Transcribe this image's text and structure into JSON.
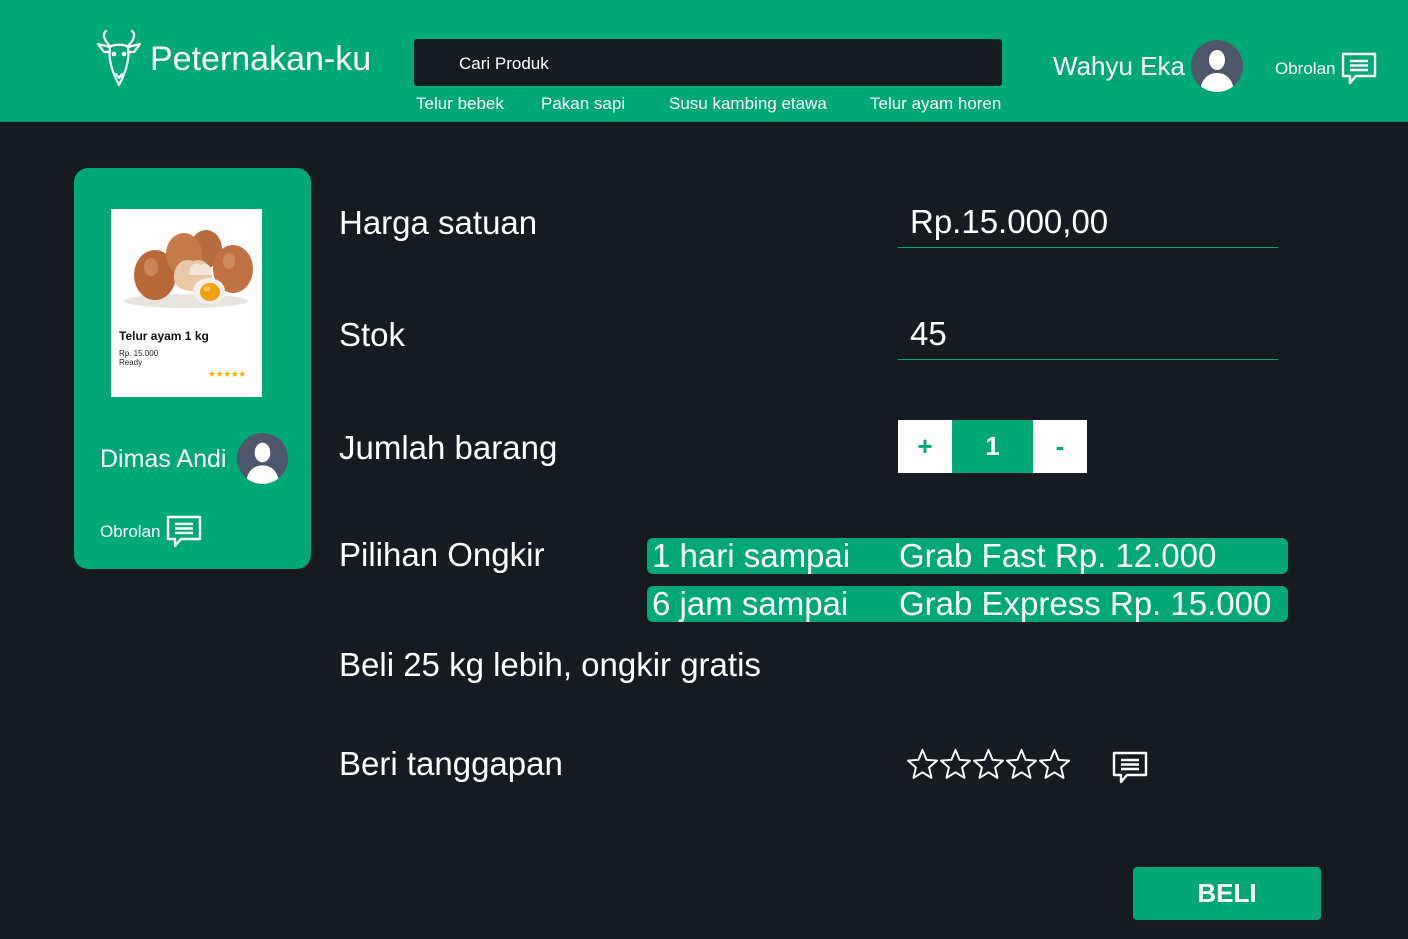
{
  "header": {
    "app_title": "Peternakan-ku",
    "search": {
      "placeholder": "Cari Produk"
    },
    "quick_links": [
      "Telur bebek",
      "Pakan sapi",
      "Susu kambing etawa",
      "Telur ayam horen"
    ],
    "user_name": "Wahyu Eka",
    "chat_label": "Obrolan"
  },
  "product_card": {
    "name": "Telur ayam 1 kg",
    "price": "Rp. 15.000",
    "status": "Ready",
    "stars": "★★★★★",
    "rating": 5,
    "seller_name": "Dimas Andi",
    "chat_label": "Obrolan"
  },
  "details": {
    "price_label": "Harga satuan",
    "price_value": "Rp.15.000,00",
    "stock_label": "Stok",
    "stock_value": "45",
    "qty_label": "Jumlah barang",
    "qty_plus": "+",
    "qty_value": "1",
    "qty_minus": "-",
    "shipping_label": "Pilihan Ongkir",
    "shipping_options": [
      {
        "time": "1 hari sampai",
        "courier": "Grab Fast Rp. 12.000"
      },
      {
        "time": "6 jam sampai",
        "courier": "Grab Express Rp. 15.000"
      }
    ],
    "promo": "Beli 25 kg lebih, ongkir gratis",
    "feedback_label": "Beri tanggapan",
    "feedback_rating": 0,
    "buy_label": "BELI"
  },
  "colors": {
    "accent": "#00a878",
    "background": "#161a22",
    "avatar": "#4f5669",
    "star_gold": "#f2b705"
  }
}
